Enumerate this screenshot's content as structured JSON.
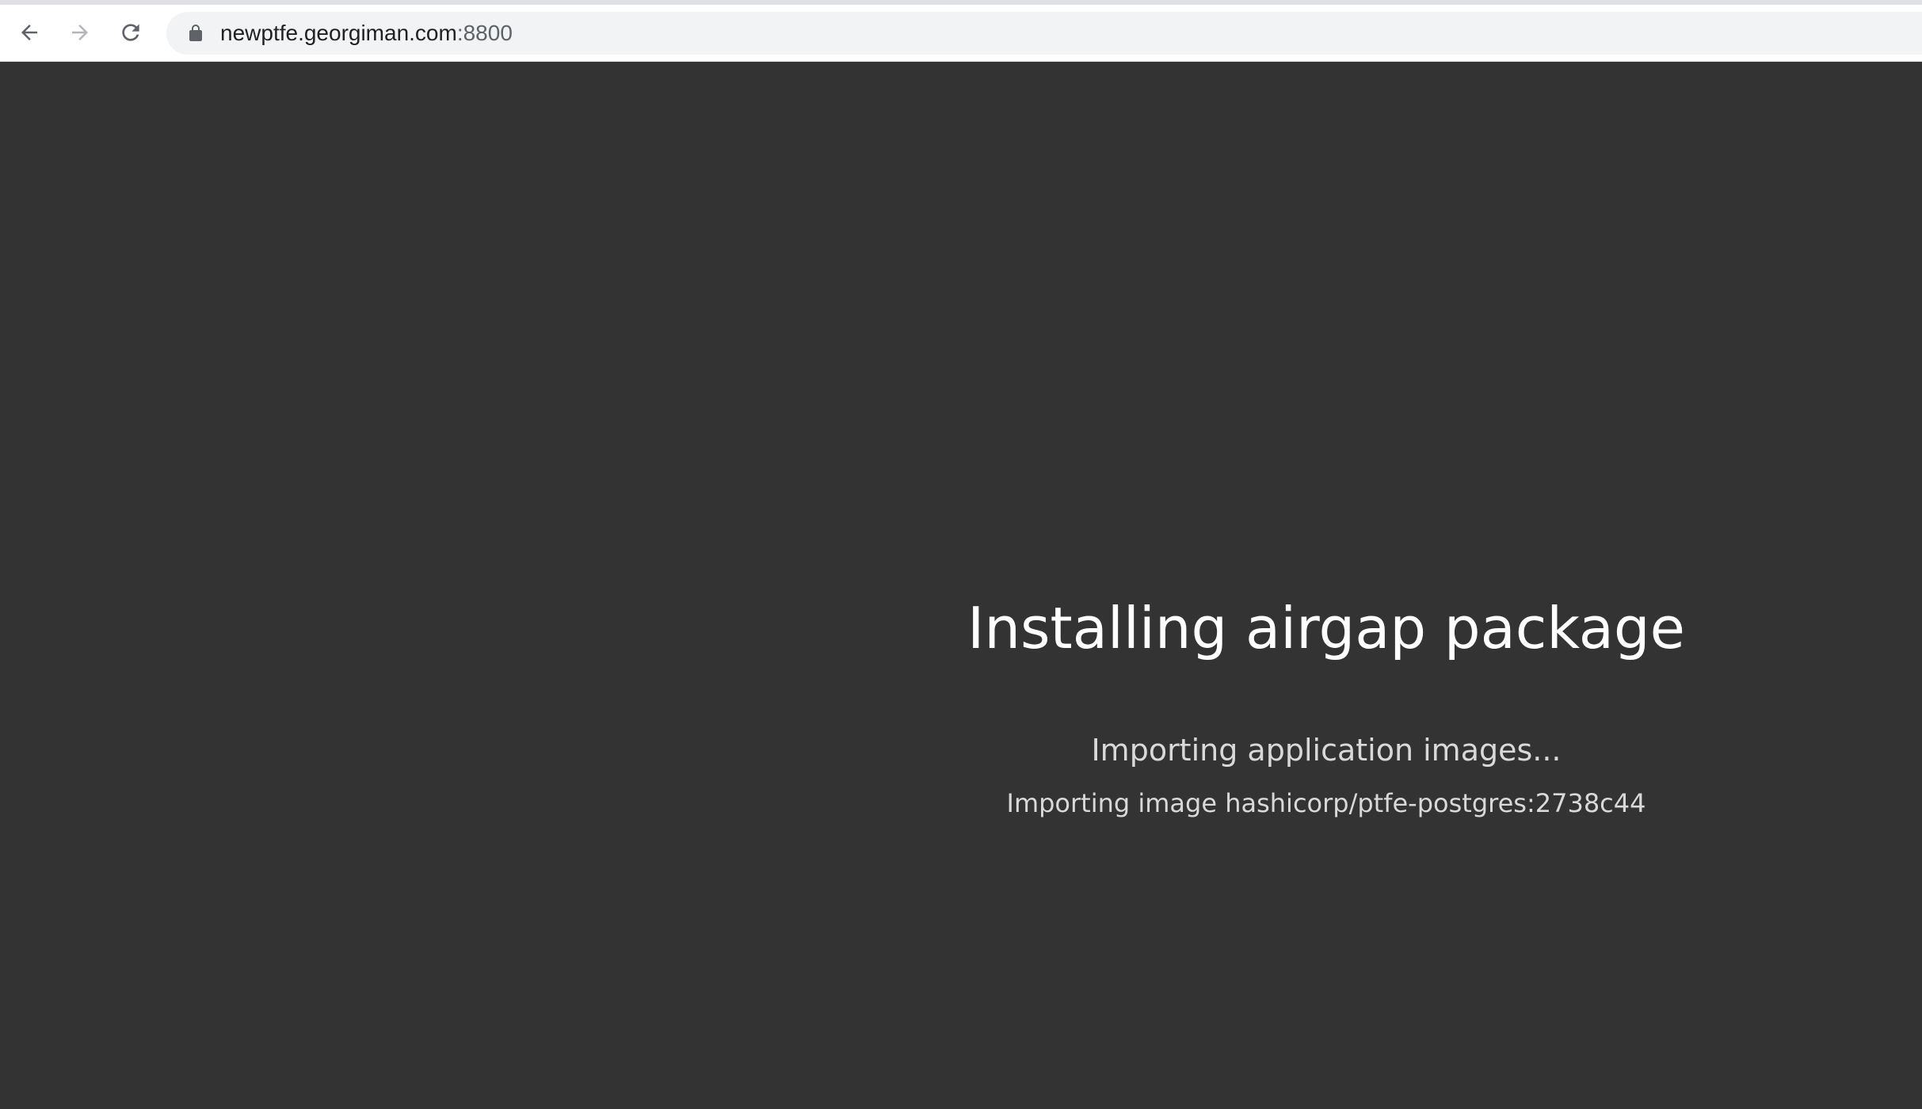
{
  "browser": {
    "url_host": "newptfe.georgiman.com",
    "url_port": ":8800",
    "icons": {
      "back": "arrow-left-icon",
      "forward": "arrow-right-icon",
      "reload": "reload-icon",
      "lock": "lock-icon"
    }
  },
  "page": {
    "title": "Installing airgap package",
    "status": "Importing application images...",
    "detail": "Importing image hashicorp/ptfe-postgres:2738c44"
  },
  "colors": {
    "page_background": "#333333",
    "title_text": "#ffffff",
    "status_text": "#d9d9d9"
  }
}
